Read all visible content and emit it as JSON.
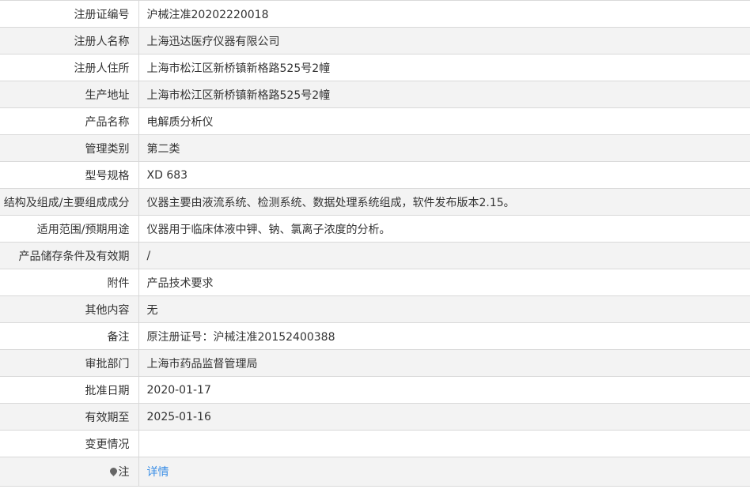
{
  "rows": [
    {
      "label": "注册证编号",
      "value": "沪械注准20202220018"
    },
    {
      "label": "注册人名称",
      "value": "上海迅达医疗仪器有限公司"
    },
    {
      "label": "注册人住所",
      "value": "上海市松江区新桥镇新格路525号2幢"
    },
    {
      "label": "生产地址",
      "value": "上海市松江区新桥镇新格路525号2幢"
    },
    {
      "label": "产品名称",
      "value": "电解质分析仪"
    },
    {
      "label": "管理类别",
      "value": "第二类"
    },
    {
      "label": "型号规格",
      "value": "XD 683"
    },
    {
      "label": "结构及组成/主要组成成分",
      "value": "仪器主要由液流系统、检测系统、数据处理系统组成，软件发布版本2.15。"
    },
    {
      "label": "适用范围/预期用途",
      "value": "仪器用于临床体液中钾、钠、氯离子浓度的分析。"
    },
    {
      "label": "产品储存条件及有效期",
      "value": "/"
    },
    {
      "label": "附件",
      "value": "产品技术要求"
    },
    {
      "label": "其他内容",
      "value": "无"
    },
    {
      "label": "备注",
      "value": "原注册证号：沪械注准20152400388"
    },
    {
      "label": "审批部门",
      "value": "上海市药品监督管理局"
    },
    {
      "label": "批准日期",
      "value": "2020-01-17"
    },
    {
      "label": "有效期至",
      "value": "2025-01-16"
    },
    {
      "label": "变更情况",
      "value": ""
    }
  ],
  "note": {
    "label": "注",
    "icon": "pin-icon",
    "link_text": "详情"
  }
}
